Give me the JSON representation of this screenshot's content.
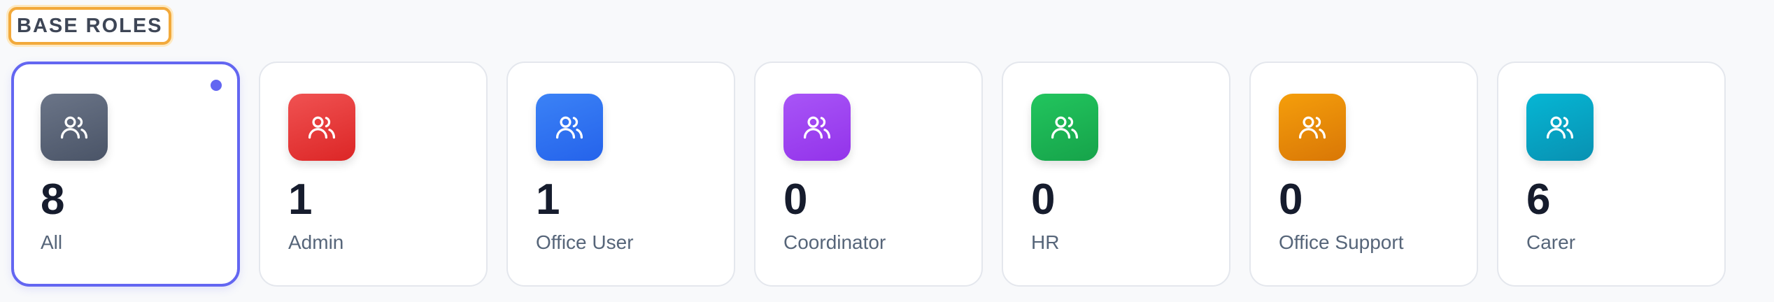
{
  "section": {
    "title": "BASE ROLES"
  },
  "colors": {
    "accent": "#6366f1",
    "highlight_border": "#f2a93b"
  },
  "roles": [
    {
      "count": "8",
      "label": "All",
      "icon": "users-icon",
      "color_from": "#6b7588",
      "color_to": "#4a5467",
      "selected": true
    },
    {
      "count": "1",
      "label": "Admin",
      "icon": "users-icon",
      "color_from": "#f05252",
      "color_to": "#dc2626",
      "selected": false
    },
    {
      "count": "1",
      "label": "Office User",
      "icon": "users-icon",
      "color_from": "#3b82f6",
      "color_to": "#2563eb",
      "selected": false
    },
    {
      "count": "0",
      "label": "Coordinator",
      "icon": "users-icon",
      "color_from": "#a855f7",
      "color_to": "#9333ea",
      "selected": false
    },
    {
      "count": "0",
      "label": "HR",
      "icon": "users-icon",
      "color_from": "#22c55e",
      "color_to": "#16a34a",
      "selected": false
    },
    {
      "count": "0",
      "label": "Office Support",
      "icon": "users-icon",
      "color_from": "#f59e0b",
      "color_to": "#d97706",
      "selected": false
    },
    {
      "count": "6",
      "label": "Carer",
      "icon": "users-icon",
      "color_from": "#06b6d4",
      "color_to": "#0891b2",
      "selected": false
    }
  ]
}
